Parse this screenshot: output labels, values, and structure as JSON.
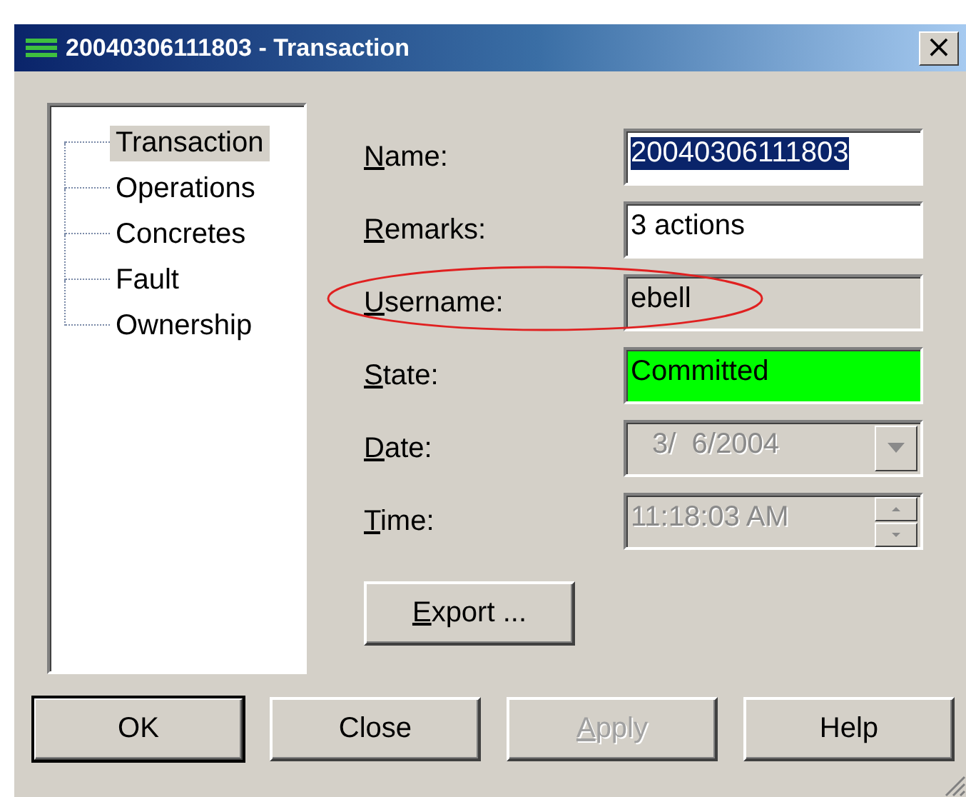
{
  "window": {
    "title": "20040306111803 - Transaction",
    "close_label": "×"
  },
  "tree": [
    {
      "label": "Transaction",
      "selected": true
    },
    {
      "label": "Operations",
      "selected": false
    },
    {
      "label": "Concretes",
      "selected": false
    },
    {
      "label": "Fault",
      "selected": false
    },
    {
      "label": "Ownership",
      "selected": false
    }
  ],
  "fields": [
    {
      "kind": "text",
      "label": "Name:",
      "value": "20040306111803",
      "text_selected": true
    },
    {
      "kind": "text",
      "label": "Remarks:",
      "value": "3 actions"
    },
    {
      "kind": "readonly",
      "label": "Username:",
      "value": "ebell",
      "annotated": true
    },
    {
      "kind": "status",
      "label": "State:",
      "value": "Committed",
      "color": "#00ff00"
    },
    {
      "kind": "date",
      "label": "Date:",
      "value": "3/  6/2004"
    },
    {
      "kind": "time",
      "label": "Time:",
      "value": "11:18:03 AM"
    }
  ],
  "export_button": {
    "label": "Export ..."
  },
  "buttons": [
    {
      "label": "OK",
      "default": true,
      "disabled": false
    },
    {
      "label": "Close",
      "default": false,
      "disabled": false
    },
    {
      "label": "Apply",
      "default": false,
      "disabled": true
    },
    {
      "label": "Help",
      "default": false,
      "disabled": false
    }
  ]
}
